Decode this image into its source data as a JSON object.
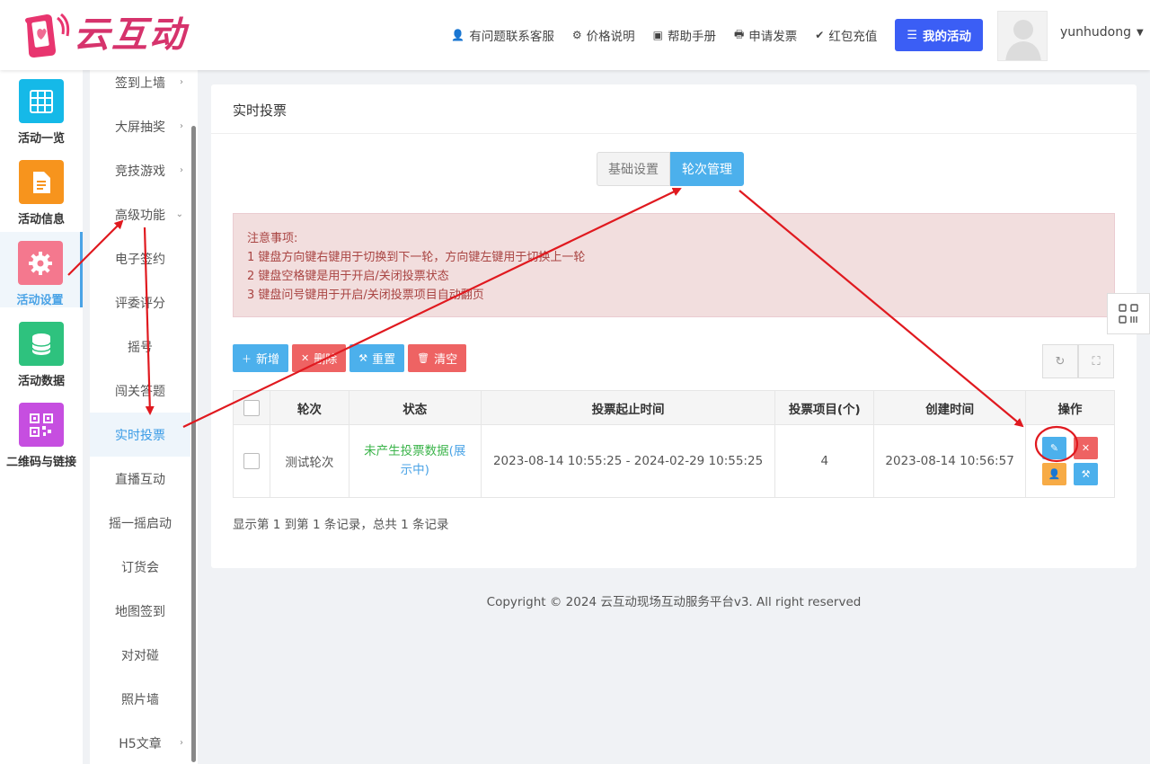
{
  "brand": {
    "name": "云互动"
  },
  "header": {
    "nav": [
      {
        "icon": "user-plus-icon",
        "glyph": "👤",
        "label": "有问题联系客服"
      },
      {
        "icon": "gear-badge-icon",
        "glyph": "⚙",
        "label": "价格说明"
      },
      {
        "icon": "book-icon",
        "glyph": "▣",
        "label": "帮助手册"
      },
      {
        "icon": "printer-icon",
        "glyph": "🖶",
        "label": "申请发票"
      },
      {
        "icon": "shield-check-icon",
        "glyph": "✔",
        "label": "红包充值"
      }
    ],
    "my_activity": {
      "icon": "list-icon",
      "glyph": "☰",
      "label": "我的活动"
    },
    "username": "yunhudong"
  },
  "icon_sidebar": [
    {
      "label": "活动一览",
      "icon": "grid-icon",
      "color": "#15b9e8",
      "glyph": "▦"
    },
    {
      "label": "活动信息",
      "icon": "document-icon",
      "color": "#f7941d",
      "glyph": "▤"
    },
    {
      "label": "活动设置",
      "icon": "gear-icon",
      "color": "#f4788e",
      "glyph": "⚙",
      "active": true
    },
    {
      "label": "活动数据",
      "icon": "database-icon",
      "color": "#2ec27e",
      "glyph": "⛁"
    },
    {
      "label": "二维码与链接",
      "icon": "qrcode-icon",
      "color": "#c64ee0",
      "glyph": "▩"
    }
  ],
  "sub_menu": [
    {
      "label": "签到上墙",
      "chevron": "›"
    },
    {
      "label": "大屏抽奖",
      "chevron": "›"
    },
    {
      "label": "竞技游戏",
      "chevron": "›"
    },
    {
      "label": "高级功能",
      "chevron": "⌄"
    },
    {
      "label": "电子签约"
    },
    {
      "label": "评委评分"
    },
    {
      "label": "摇号"
    },
    {
      "label": "闯关答题"
    },
    {
      "label": "实时投票",
      "active": true
    },
    {
      "label": "直播互动"
    },
    {
      "label": "摇一摇启动"
    },
    {
      "label": "订货会"
    },
    {
      "label": "地图签到"
    },
    {
      "label": "对对碰"
    },
    {
      "label": "照片墙"
    },
    {
      "label": "H5文章",
      "chevron": "›"
    }
  ],
  "panel": {
    "title": "实时投票",
    "tabs": [
      {
        "label": "基础设置",
        "active": false
      },
      {
        "label": "轮次管理",
        "active": true
      }
    ],
    "notice": {
      "heading": "注意事项:",
      "lines": [
        "1 键盘方向键右键用于切换到下一轮，方向键左键用于切换上一轮",
        "2 键盘空格键是用于开启/关闭投票状态",
        "3 键盘问号键用于开启/关闭投票项目自动翻页"
      ]
    },
    "toolbar": {
      "add": "新增",
      "delete": "删除",
      "reset": "重置",
      "clear": "清空"
    },
    "table": {
      "headers": [
        "轮次",
        "状态",
        "投票起止时间",
        "投票项目(个)",
        "创建时间",
        "操作"
      ],
      "rows": [
        {
          "round": "测试轮次",
          "status_a": "未产生投票数据",
          "status_b": "(展示中)",
          "time_range": "2023-08-14 10:55:25 - 2024-02-29 10:55:25",
          "items": "4",
          "created": "2023-08-14 10:56:57"
        }
      ]
    },
    "pager_info": "显示第 1 到第 1 条记录，总共 1 条记录"
  },
  "footer": "Copyright © 2024 云互动现场互动服务平台v3. All right reserved",
  "colors": {
    "accent": "#4cb0ec",
    "primary_button": "#3b5ef5",
    "danger": "#ee6363",
    "warning": "#f7ab46",
    "annotation": "#e0191f"
  }
}
